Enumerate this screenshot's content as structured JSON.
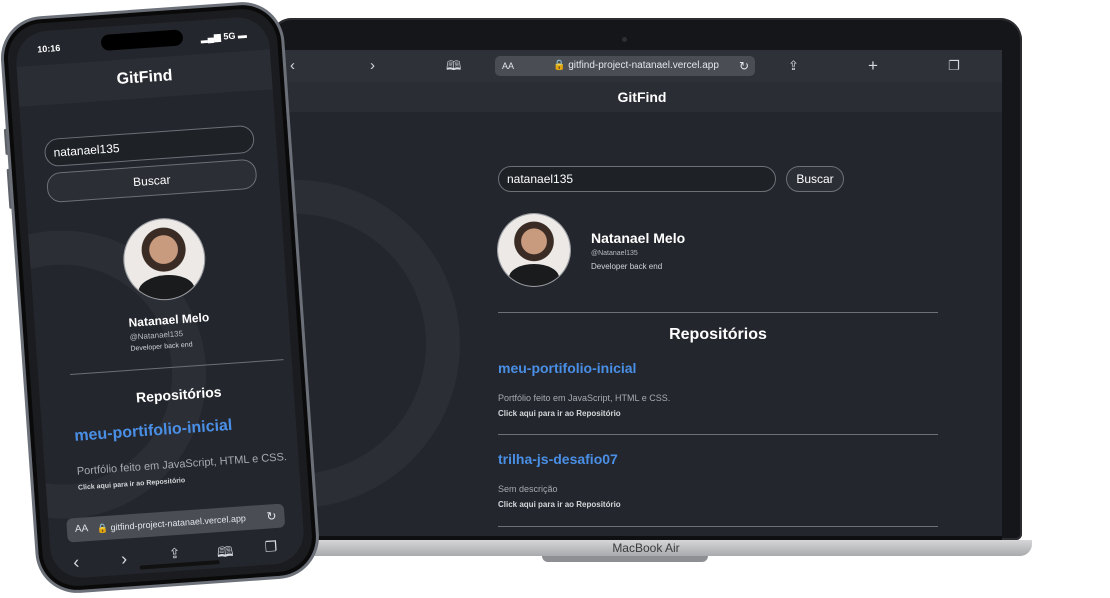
{
  "laptop": {
    "browser": {
      "aa_label": "AA",
      "url": "gitfind-project-natanael.vercel.app",
      "icons": [
        "back-icon",
        "forward-icon",
        "bookmarks-icon",
        "reload-icon",
        "share-icon",
        "new-tab-icon",
        "tabs-icon"
      ]
    },
    "app_title": "GitFind",
    "search": {
      "value": "natanael135",
      "button": "Buscar"
    },
    "profile": {
      "name": "Natanael Melo",
      "username": "@Natanael135",
      "bio": "Developer back end"
    },
    "section_title": "Repositórios",
    "repos": [
      {
        "name": "meu-portifolio-inicial",
        "description": "Portfólio feito em JavaScript, HTML e CSS.",
        "link": "Click aqui para ir ao Repositório"
      },
      {
        "name": "trilha-js-desafio07",
        "description": "Sem descrição",
        "link": "Click aqui para ir ao Repositório"
      }
    ],
    "base_label": "MacBook Air"
  },
  "phone": {
    "status": {
      "time": "10:16",
      "signal": "5G"
    },
    "app_title": "GitFind",
    "search": {
      "value": "natanael135",
      "button": "Buscar"
    },
    "profile": {
      "name": "Natanael Melo",
      "username": "@Natanael135",
      "bio": "Developer back end"
    },
    "section_title": "Repositórios",
    "repo": {
      "name": "meu-portifolio-inicial",
      "description": "Portfólio feito em JavaScript, HTML e CSS.",
      "link": "Click aqui para ir ao Repositório"
    },
    "browser": {
      "aa_label": "AA",
      "url": "gitfind-project-natanael.vercel.app"
    }
  },
  "colors": {
    "background": "#23262c",
    "header": "#2a2d33",
    "accent_link": "#4a8fe6",
    "text": "#ffffff"
  }
}
